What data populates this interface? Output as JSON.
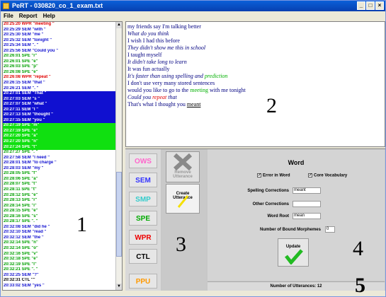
{
  "window": {
    "title": "PeRT - 030820_co_1_exam.txt",
    "buttons": [
      "_",
      "□",
      "×"
    ]
  },
  "menu": [
    "File",
    "Report",
    "Help"
  ],
  "log_rows": [
    {
      "text": "20:25:20 WPR \"meeting \"",
      "color": "#e00000",
      "bg": ""
    },
    {
      "text": "20:25:29 SEM \"with \"",
      "color": "#1010d0",
      "bg": ""
    },
    {
      "text": "20:25:30 SEM \"me \"",
      "color": "#1010d0",
      "bg": ""
    },
    {
      "text": "20:25:32 SEM \"tonight \"",
      "color": "#1010d0",
      "bg": ""
    },
    {
      "text": "20:25:34 SEM \". \"",
      "color": "#1010d0",
      "bg": ""
    },
    {
      "text": "20:25:56 SEM \"Could you \"",
      "color": "#1010d0",
      "bg": ""
    },
    {
      "text": "20:26:01 SPE \"r\"",
      "color": "#00a000",
      "bg": ""
    },
    {
      "text": "20:26:01 SPE \"e\"",
      "color": "#00a000",
      "bg": ""
    },
    {
      "text": "20:26:03 SPE \"p\"",
      "color": "#00a000",
      "bg": ""
    },
    {
      "text": "20:26:08 SPE \"e\"",
      "color": "#00a000",
      "bg": ""
    },
    {
      "text": "20:26:08 WPR \"repeat \"",
      "color": "#e00000",
      "bg": ""
    },
    {
      "text": "20:26:15 SEM \"that \"",
      "color": "#1010d0",
      "bg": ""
    },
    {
      "text": "20:26:21 SEM \". \"",
      "color": "#1010d0",
      "bg": ""
    },
    {
      "text": "20:27:01 SEM \"That \"",
      "color": "#ffffff",
      "bg": "#1010d0"
    },
    {
      "text": "20:27:03 SEM \"s \"",
      "color": "#ffffff",
      "bg": "#1010d0"
    },
    {
      "text": "20:27:07 SEM \"what \"",
      "color": "#ffffff",
      "bg": "#1010d0"
    },
    {
      "text": "20:27:11 SEM \"I \"",
      "color": "#ffffff",
      "bg": "#1010d0"
    },
    {
      "text": "20:27:13 SEM \"thought \"",
      "color": "#ffffff",
      "bg": "#1010d0"
    },
    {
      "text": "20:27:15 SEM \"you \"",
      "color": "#ffffff",
      "bg": "#1010d0"
    },
    {
      "text": "20:27:19 SPE \"m\"",
      "color": "#ffffff",
      "bg": "#10e010"
    },
    {
      "text": "20:27:19 SPE \"e\"",
      "color": "#ffffff",
      "bg": "#10e010"
    },
    {
      "text": "20:27:20 SPE \"a\"",
      "color": "#ffffff",
      "bg": "#10e010"
    },
    {
      "text": "20:27:20 SPE \"n\"",
      "color": "#ffffff",
      "bg": "#10e010"
    },
    {
      "text": "20:27:24 SPE \"t\"",
      "color": "#ffffff",
      "bg": "#10e010"
    },
    {
      "text": "20:27:27 SPE \". \"",
      "color": "#00a000",
      "bg": ""
    },
    {
      "text": "20:27:58 SEM \"I need \"",
      "color": "#1010d0",
      "bg": ""
    },
    {
      "text": "20:28:01 SEM \"to charge \"",
      "color": "#1010d0",
      "bg": ""
    },
    {
      "text": "20:28:03 SEM \"my \"",
      "color": "#1010d0",
      "bg": ""
    },
    {
      "text": "20:28:05 SPE \"f\"",
      "color": "#00a000",
      "bg": ""
    },
    {
      "text": "20:28:06 SPE \"a\"",
      "color": "#00a000",
      "bg": ""
    },
    {
      "text": "20:28:07 SPE \"t\"",
      "color": "#00a000",
      "bg": ""
    },
    {
      "text": "20:28:11 SPE \"t\"",
      "color": "#00a000",
      "bg": ""
    },
    {
      "text": "20:28:12 SPE \"e\"",
      "color": "#00a000",
      "bg": ""
    },
    {
      "text": "20:28:13 SPE \"r\"",
      "color": "#00a000",
      "bg": ""
    },
    {
      "text": "20:28:14 SPE \"i\"",
      "color": "#00a000",
      "bg": ""
    },
    {
      "text": "20:28:15 SPE \"e\"",
      "color": "#00a000",
      "bg": ""
    },
    {
      "text": "20:28:16 SPE \"s\"",
      "color": "#00a000",
      "bg": ""
    },
    {
      "text": "20:28:17 SPE \". \"",
      "color": "#00a000",
      "bg": ""
    },
    {
      "text": "20:32:08 SEM \"did he \"",
      "color": "#1010d0",
      "bg": ""
    },
    {
      "text": "20:32:10 SEM \"read \"",
      "color": "#1010d0",
      "bg": ""
    },
    {
      "text": "20:32:12 SEM \"the \"",
      "color": "#1010d0",
      "bg": ""
    },
    {
      "text": "20:32:14 SPE \"n\"",
      "color": "#00a000",
      "bg": ""
    },
    {
      "text": "20:32:14 SPE \"o\"",
      "color": "#00a000",
      "bg": ""
    },
    {
      "text": "20:32:16 SPE \"v\"",
      "color": "#00a000",
      "bg": ""
    },
    {
      "text": "20:32:18 SPE \"e\"",
      "color": "#00a000",
      "bg": ""
    },
    {
      "text": "20:32:19 SPE \"l\"",
      "color": "#00a000",
      "bg": ""
    },
    {
      "text": "20:32:21 SPE \". \"",
      "color": "#00a000",
      "bg": ""
    },
    {
      "text": "20:32:25 SEM \"?\"",
      "color": "#1010d0",
      "bg": ""
    },
    {
      "text": "20:32:31 CTL \"\"",
      "color": "#000000",
      "bg": ""
    },
    {
      "text": "20:33:02 SEM \"yes \"",
      "color": "#1010d0",
      "bg": ""
    }
  ],
  "sentences": [
    {
      "parts": [
        {
          "t": "my friends say I'm talking better",
          "c": "#000080"
        }
      ],
      "italic": false
    },
    {
      "parts": [
        {
          "t": "What do you think",
          "c": "#000080"
        }
      ],
      "italic": true
    },
    {
      "parts": [
        {
          "t": "I wish I had this before",
          "c": "#000080"
        }
      ],
      "italic": false
    },
    {
      "parts": [
        {
          "t": "They didn't show me this in school",
          "c": "#000080"
        }
      ],
      "italic": true
    },
    {
      "parts": [
        {
          "t": "I taught myself",
          "c": "#000080"
        }
      ],
      "italic": false
    },
    {
      "parts": [
        {
          "t": "It didn't take long to learn",
          "c": "#000080"
        }
      ],
      "italic": true
    },
    {
      "parts": [
        {
          "t": "It was fun actually",
          "c": "#000080"
        }
      ],
      "italic": false
    },
    {
      "parts": [
        {
          "t": "It's faster than using spelling and ",
          "c": "#000080"
        },
        {
          "t": "prediction",
          "c": "#00b000"
        }
      ],
      "italic": true
    },
    {
      "parts": [
        {
          "t": "I don't use very many stored sentences",
          "c": "#000080"
        }
      ],
      "italic": false
    },
    {
      "parts": [
        {
          "t": "would you like to go to the ",
          "c": "#000080"
        },
        {
          "t": "meeting",
          "c": "#00b000"
        },
        {
          "t": " with me tonight",
          "c": "#000080"
        }
      ],
      "italic": false
    },
    {
      "parts": [
        {
          "t": "Could you ",
          "c": "#000080"
        },
        {
          "t": "repeat",
          "c": "#e00000"
        },
        {
          "t": " that",
          "c": "#000080"
        }
      ],
      "italic": true
    },
    {
      "parts": [
        {
          "t": "That's what I thought you ",
          "c": "#000080"
        },
        {
          "t": "meant",
          "c": "#000000",
          "u": true
        }
      ],
      "italic": false
    }
  ],
  "categories": [
    {
      "label": "OWS",
      "color": "#ff66cc"
    },
    {
      "label": "SEM",
      "color": "#3333ff"
    },
    {
      "label": "SMP",
      "color": "#33cccc"
    },
    {
      "label": "SPE",
      "color": "#00aa00"
    },
    {
      "label": "WPR",
      "color": "#ee0000"
    },
    {
      "label": "CTL",
      "color": "#000000"
    },
    {
      "label": "PPU",
      "color": "#ff9900"
    }
  ],
  "remove_btn": "Remove Utterance",
  "create_btn": "Create Utterance",
  "word_panel": {
    "title": "Word",
    "error_in_word": "Error in Word",
    "core_vocab": "Core Vocabulary",
    "spelling_label": "Spelling Corrections",
    "spelling_value": "meant",
    "other_label": "Other Corrections",
    "other_value": "",
    "root_label": "Word Root",
    "root_value": "mean",
    "bound_label": "Number of Bound Morphemes",
    "bound_value": "0",
    "update_btn": "Update"
  },
  "status": "Number of Utterances: 12",
  "annotations": [
    "1",
    "2",
    "3",
    "4",
    "5"
  ]
}
